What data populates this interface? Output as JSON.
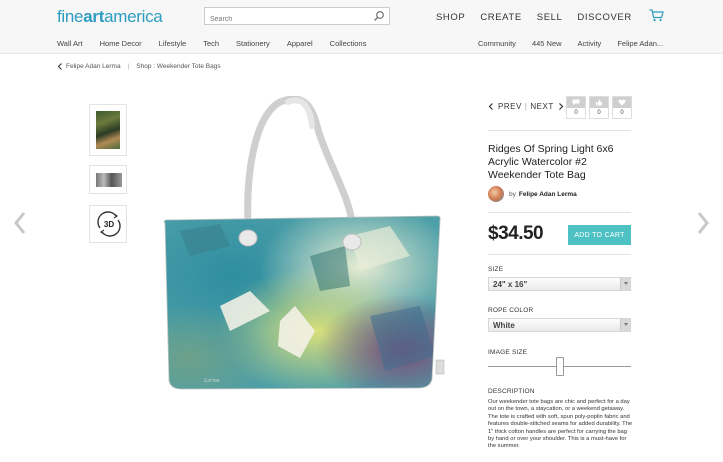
{
  "header": {
    "logo": {
      "part1": "fine",
      "part2": "art",
      "part3": "america"
    },
    "search": {
      "placeholder": "Search",
      "value": ""
    },
    "main_nav": [
      "SHOP",
      "CREATE",
      "SELL",
      "DISCOVER"
    ],
    "sub_nav_left": [
      "Wall Art",
      "Home Decor",
      "Lifestyle",
      "Tech",
      "Stationery",
      "Apparel",
      "Collections"
    ],
    "sub_nav_right": [
      "Community",
      "445 New",
      "Activity",
      "Felipe Adan..."
    ]
  },
  "breadcrumb": {
    "artist": "Felipe Adan Lerma",
    "separator": "|",
    "path": "Shop : Weekender Tote Bags"
  },
  "navigation": {
    "prev": "PREV",
    "divider": "|",
    "next": "NEXT"
  },
  "counters": [
    {
      "icon": "comment-icon",
      "value": "0"
    },
    {
      "icon": "like-icon",
      "value": "0"
    },
    {
      "icon": "heart-icon",
      "value": "0"
    }
  ],
  "product": {
    "title": "Ridges Of Spring Light 6x6 Acrylic Watercolor #2 Weekender Tote Bag",
    "artist_prefix": "by",
    "artist_name": "Felipe Adan Lerma",
    "price": "$34.50",
    "add_to_cart": "ADD TO CART",
    "signature": "Lerma"
  },
  "options": {
    "size_label": "SIZE",
    "size_value": "24\" x 16\"",
    "rope_label": "ROPE COLOR",
    "rope_value": "White",
    "image_size_label": "IMAGE SIZE",
    "image_size_level": 0.5
  },
  "description": {
    "label": "DESCRIPTION",
    "text": "Our weekender tote bags are chic and perfect for a day out on the town, a staycation, or a weekend getaway.  The tote is crafted with soft, spun poly-poplin fabric and features double-stitched seams for added durability.  The 1\" thick cotton handles are perfect for carrying the bag by hand or over your shoulder.   This is a must-have for the summer."
  },
  "colors": {
    "brand": "#2c9cc1",
    "accent": "#4ec1c3"
  },
  "icons": {
    "search": "search-icon",
    "cart": "cart-icon",
    "back": "chevron-left-icon",
    "page_prev": "chevron-left-icon",
    "page_next": "chevron-right-icon",
    "three_d": "3d-rotate-icon"
  }
}
